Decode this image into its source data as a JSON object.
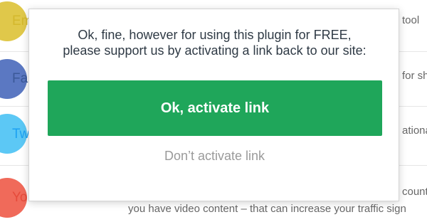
{
  "background": {
    "rows": [
      {
        "name": "Em",
        "name_color": "#d4b82c",
        "circle_color": "#e0c84a",
        "desc": "tool"
      },
      {
        "name": "Fa",
        "name_color": "#3b5998",
        "circle_color": "#5b78c2",
        "desc": "for sh"
      },
      {
        "name": "Tw",
        "name_color": "#1da1f2",
        "circle_color": "#5cc8f5",
        "desc": "ational"
      },
      {
        "name": "Yo",
        "name_color": "#e64b3b",
        "circle_color": "#f06a5a",
        "desc": "count",
        "desc2": "you have video content – that can increase your traffic sign"
      }
    ]
  },
  "modal": {
    "message_line1": "Ok, fine, however for using this plugin for FREE,",
    "message_line2": "please support us by activating a link back to our site:",
    "activate_button_label": "Ok, activate link",
    "dont_activate_label": "Don’t activate link"
  }
}
